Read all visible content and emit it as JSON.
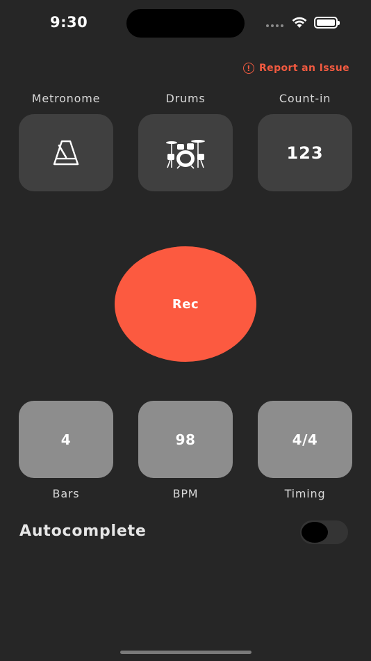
{
  "status": {
    "time": "9:30"
  },
  "report": {
    "icon": "warning-circle-icon",
    "label": "Report an Issue",
    "color": "#f25a40"
  },
  "top_tiles": [
    {
      "label": "Metronome",
      "icon": "metronome-icon"
    },
    {
      "label": "Drums",
      "icon": "drum-kit-icon"
    },
    {
      "label": "Count-in",
      "value": "123"
    }
  ],
  "record": {
    "label": "Rec",
    "color": "#fc5a40"
  },
  "settings": [
    {
      "value": "4",
      "label": "Bars"
    },
    {
      "value": "98",
      "label": "BPM"
    },
    {
      "value": "4/4",
      "label": "Timing"
    }
  ],
  "autocomplete": {
    "label": "Autocomplete",
    "enabled": false
  }
}
